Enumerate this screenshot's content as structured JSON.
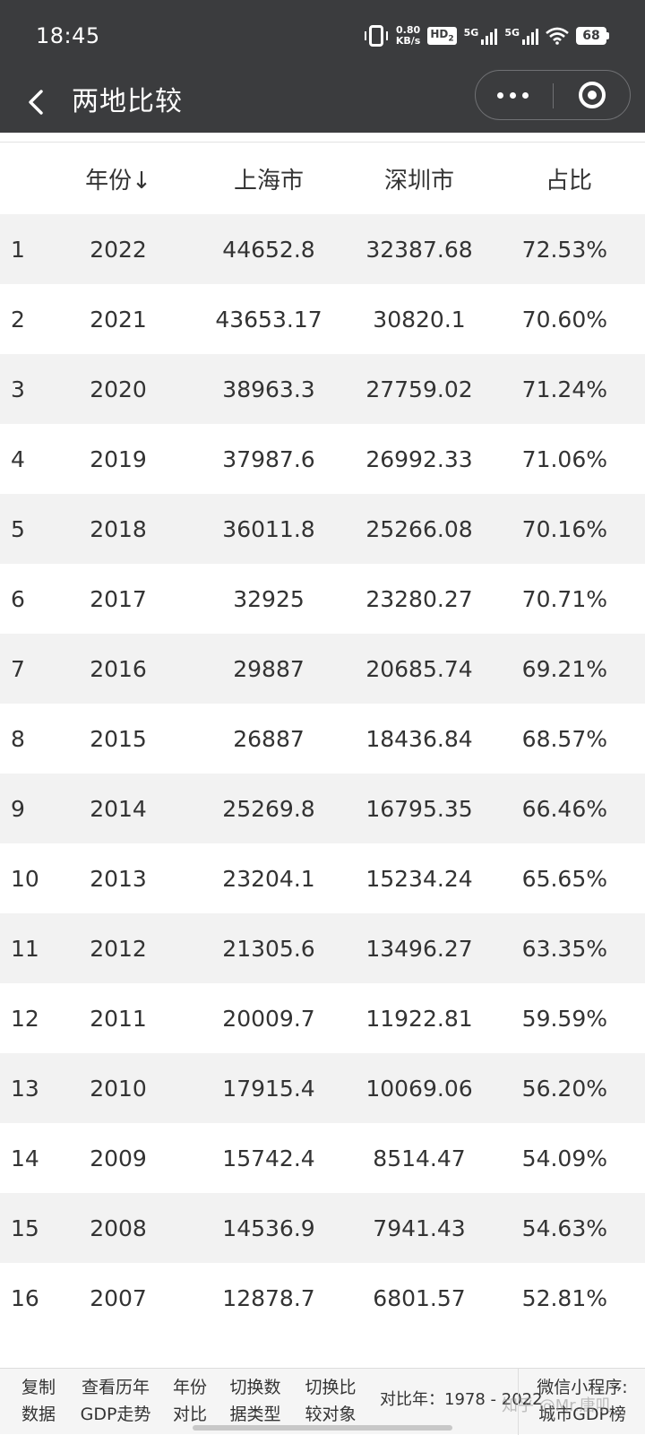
{
  "status_bar": {
    "time": "18:45",
    "net_speed_value": "0.80",
    "net_speed_unit": "KB/s",
    "hd_label": "HD",
    "hd_sub": "2",
    "sig1_label": "5G",
    "sig2_label": "5G",
    "battery": "68"
  },
  "nav": {
    "title": "两地比较"
  },
  "table": {
    "headers": [
      "年份↓",
      "上海市",
      "深圳市",
      "占比"
    ],
    "rows": [
      {
        "idx": "1",
        "year": "2022",
        "sh": "44652.8",
        "sz": "32387.68",
        "ratio": "72.53%"
      },
      {
        "idx": "2",
        "year": "2021",
        "sh": "43653.17",
        "sz": "30820.1",
        "ratio": "70.60%"
      },
      {
        "idx": "3",
        "year": "2020",
        "sh": "38963.3",
        "sz": "27759.02",
        "ratio": "71.24%"
      },
      {
        "idx": "4",
        "year": "2019",
        "sh": "37987.6",
        "sz": "26992.33",
        "ratio": "71.06%"
      },
      {
        "idx": "5",
        "year": "2018",
        "sh": "36011.8",
        "sz": "25266.08",
        "ratio": "70.16%"
      },
      {
        "idx": "6",
        "year": "2017",
        "sh": "32925",
        "sz": "23280.27",
        "ratio": "70.71%"
      },
      {
        "idx": "7",
        "year": "2016",
        "sh": "29887",
        "sz": "20685.74",
        "ratio": "69.21%"
      },
      {
        "idx": "8",
        "year": "2015",
        "sh": "26887",
        "sz": "18436.84",
        "ratio": "68.57%"
      },
      {
        "idx": "9",
        "year": "2014",
        "sh": "25269.8",
        "sz": "16795.35",
        "ratio": "66.46%"
      },
      {
        "idx": "10",
        "year": "2013",
        "sh": "23204.1",
        "sz": "15234.24",
        "ratio": "65.65%"
      },
      {
        "idx": "11",
        "year": "2012",
        "sh": "21305.6",
        "sz": "13496.27",
        "ratio": "63.35%"
      },
      {
        "idx": "12",
        "year": "2011",
        "sh": "20009.7",
        "sz": "11922.81",
        "ratio": "59.59%"
      },
      {
        "idx": "13",
        "year": "2010",
        "sh": "17915.4",
        "sz": "10069.06",
        "ratio": "56.20%"
      },
      {
        "idx": "14",
        "year": "2009",
        "sh": "15742.4",
        "sz": "8514.47",
        "ratio": "54.09%"
      },
      {
        "idx": "15",
        "year": "2008",
        "sh": "14536.9",
        "sz": "7941.43",
        "ratio": "54.63%"
      },
      {
        "idx": "16",
        "year": "2007",
        "sh": "12878.7",
        "sz": "6801.57",
        "ratio": "52.81%"
      }
    ]
  },
  "bottom_bar": {
    "copy_l1": "复制",
    "copy_l2": "数据",
    "trend_l1": "查看历年",
    "trend_l2": "GDP走势",
    "yearcmp_l1": "年份",
    "yearcmp_l2": "对比",
    "switchtype_l1": "切换数",
    "switchtype_l2": "据类型",
    "switchobj_l1": "切换比",
    "switchobj_l2": "较对象",
    "range": "对比年：1978 - 2022",
    "mini_l1": "微信小程序:",
    "mini_l2": "城市GDP榜"
  },
  "watermark": "知乎 @Mr.唐叽"
}
